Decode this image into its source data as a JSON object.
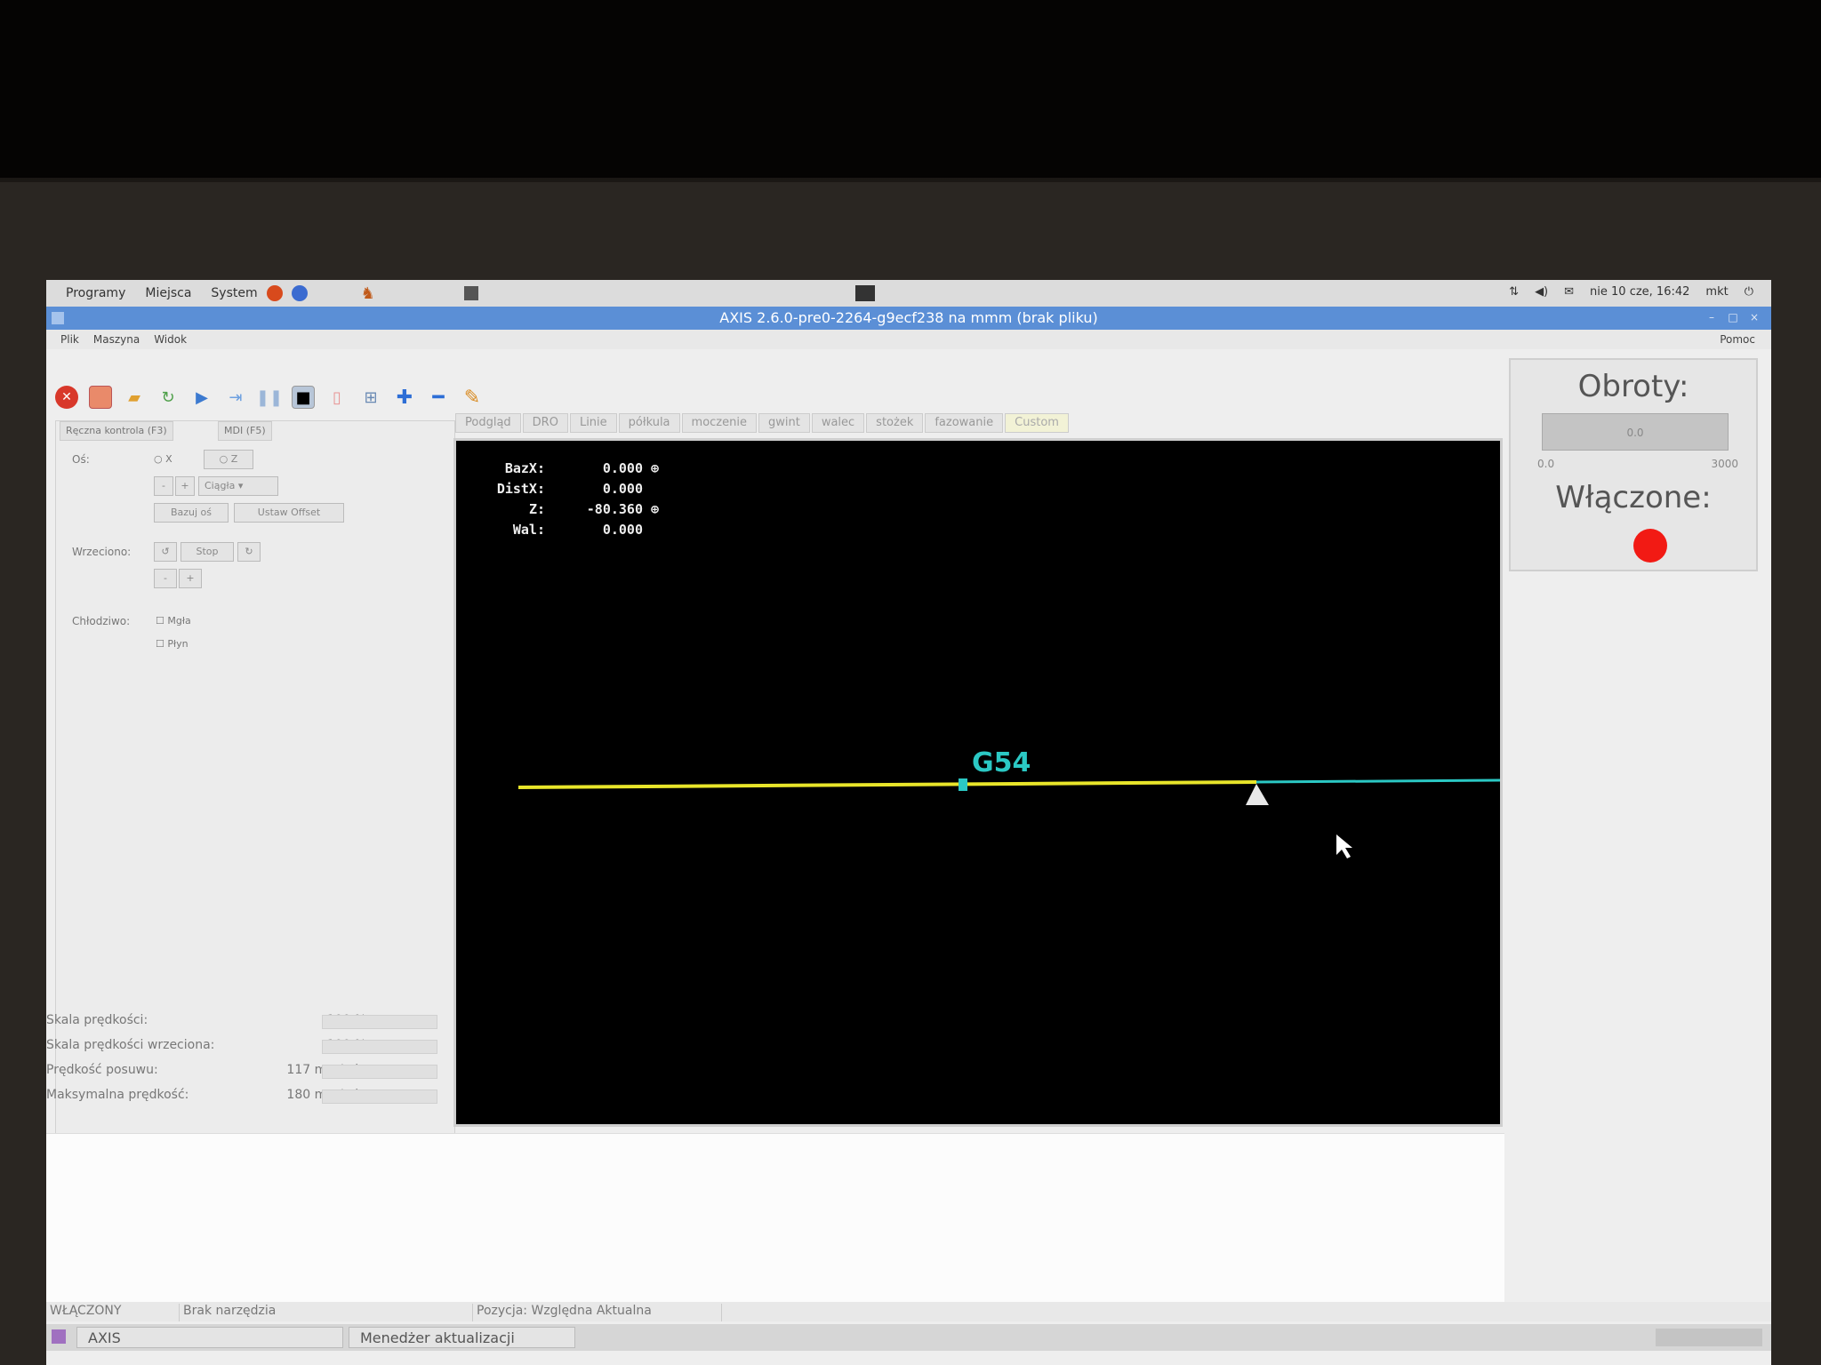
{
  "panel": {
    "menus": [
      "Programy",
      "Miejsca",
      "System"
    ],
    "clock": "nie 10 cze, 16:42",
    "user": "mkt"
  },
  "window": {
    "title": "AXIS 2.6.0-pre0-2264-g9ecf238 na mmm (brak pliku)"
  },
  "menubar": {
    "items": [
      "Plik",
      "Maszyna",
      "Widok"
    ],
    "help": "Pomoc"
  },
  "left": {
    "tabs": [
      "Ręczna kontrola (F3)",
      "MDI (F5)"
    ],
    "axis_label": "Oś:",
    "axis_x": "X",
    "axis_z": "Z",
    "step_value": "Ciągła",
    "home_button": "Bazuj oś",
    "touch_off_button": "Ustaw Offset",
    "spindle_label": "Wrzeciono:",
    "spindle_stop": "Stop",
    "coolant_label": "Chłodziwo:",
    "mist": "Mgła",
    "flood": "Płyn"
  },
  "sliders": [
    {
      "name": "Skala prędkości:",
      "value": "100 %"
    },
    {
      "name": "Skala prędkości wrzeciona:",
      "value": "100 %"
    },
    {
      "name": "Prędkość posuwu:",
      "value": "117 mm/min"
    },
    {
      "name": "Maksymalna prędkość:",
      "value": "180 mm/min"
    }
  ],
  "preview_tabs": [
    "Podgląd",
    "DRO",
    "Linie",
    "półkula",
    "moczenie",
    "gwint",
    "walec",
    "stożek",
    "fazowanie",
    "Custom"
  ],
  "dro": [
    {
      "axis": "BazX:",
      "value": "0.000"
    },
    {
      "axis": "DistX:",
      "value": "0.000"
    },
    {
      "axis": "Z:",
      "value": "-80.360"
    },
    {
      "axis": "Wal:",
      "value": "0.000"
    }
  ],
  "preview": {
    "origin_label": "G54",
    "path_color": "#e8e52a",
    "limit_color": "#2bc8c4"
  },
  "right": {
    "rpm_title": "Obroty:",
    "rpm_value": "0.0",
    "rpm_min": "0.0",
    "rpm_max": "3000",
    "on_title": "Włączone:",
    "led_color": "#f21a14"
  },
  "status": {
    "state": "WŁĄCZONY",
    "tool": "Brak narzędzia",
    "position": "Pozycja: Względna Aktualna"
  },
  "taskbar": {
    "tasks": [
      "AXIS",
      "Menedżer aktualizacji"
    ]
  }
}
